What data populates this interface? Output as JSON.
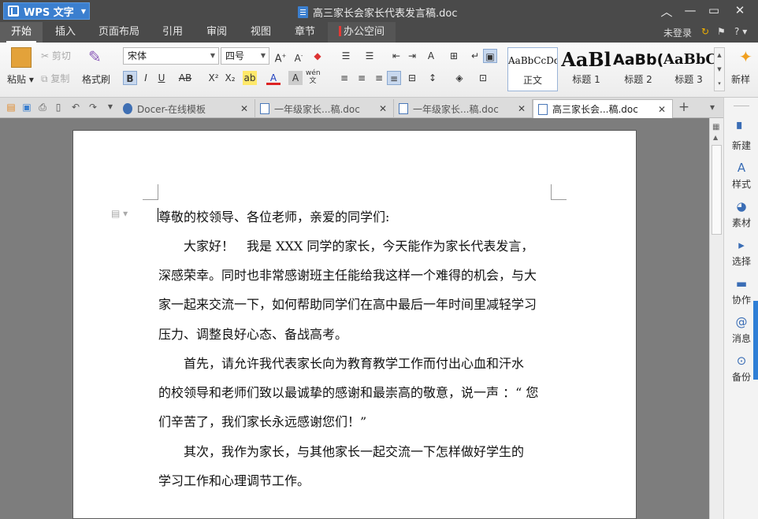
{
  "app": {
    "name": "WPS 文字",
    "window_title": "高三家长会家长代表发言稿.doc"
  },
  "window_controls": {
    "collapse": "︿",
    "minimize": "—",
    "maximize": "▭",
    "close": "✕"
  },
  "menu": {
    "tabs": [
      "开始",
      "插入",
      "页面布局",
      "引用",
      "审阅",
      "视图",
      "章节",
      "办公空间"
    ],
    "login": "未登录",
    "help": "?"
  },
  "ribbon": {
    "paste": "粘贴",
    "cut": "剪切",
    "copy": "复制",
    "format_painter": "格式刷",
    "font_name": "宋体",
    "font_size": "四号",
    "styles": [
      {
        "preview": "AaBbCcDd",
        "label": "正文"
      },
      {
        "preview": "AaBl",
        "label": "标题 1"
      },
      {
        "preview": "AaBb(",
        "label": "标题 2"
      },
      {
        "preview": "AaBbC",
        "label": "标题 3"
      }
    ],
    "new_style": "新样"
  },
  "doc_tabs": [
    {
      "title": "Docer-在线模板",
      "active": false
    },
    {
      "title": "一年级家长...稿.doc",
      "active": false
    },
    {
      "title": "一年级家长...稿.doc",
      "active": false
    },
    {
      "title": "高三家长会...稿.doc",
      "active": true
    }
  ],
  "document": {
    "lines": [
      "尊敬的校领导、各位老师，亲爱的同学们:",
      "　　大家好！　我是 XXX 同学的家长，今天能作为家长代表发言，",
      "深感荣幸。同时也非常感谢班主任能给我这样一个难得的机会，与大",
      "家一起来交流一下，如何帮助同学们在高中最后一年时间里减轻学习",
      "压力、调整良好心态、备战高考。",
      "　　首先，请允许我代表家长向为教育教学工作而付出心血和汗水",
      "的校领导和老师们致以最诚挚的感谢和最崇高的敬意，说一声 ：“ 您",
      "们辛苦了，我们家长永远感谢您们！”",
      "　　其次，我作为家长，与其他家长一起交流一下怎样做好学生的",
      "学习工作和心理调节工作。"
    ]
  },
  "right_panel": [
    "新建",
    "样式",
    "素材",
    "选择",
    "协作",
    "消息",
    "备份"
  ],
  "colors": {
    "accent": "#3b7fcf",
    "titlebar": "#4a4a4a",
    "panel_edge": "#2f7fd6"
  }
}
